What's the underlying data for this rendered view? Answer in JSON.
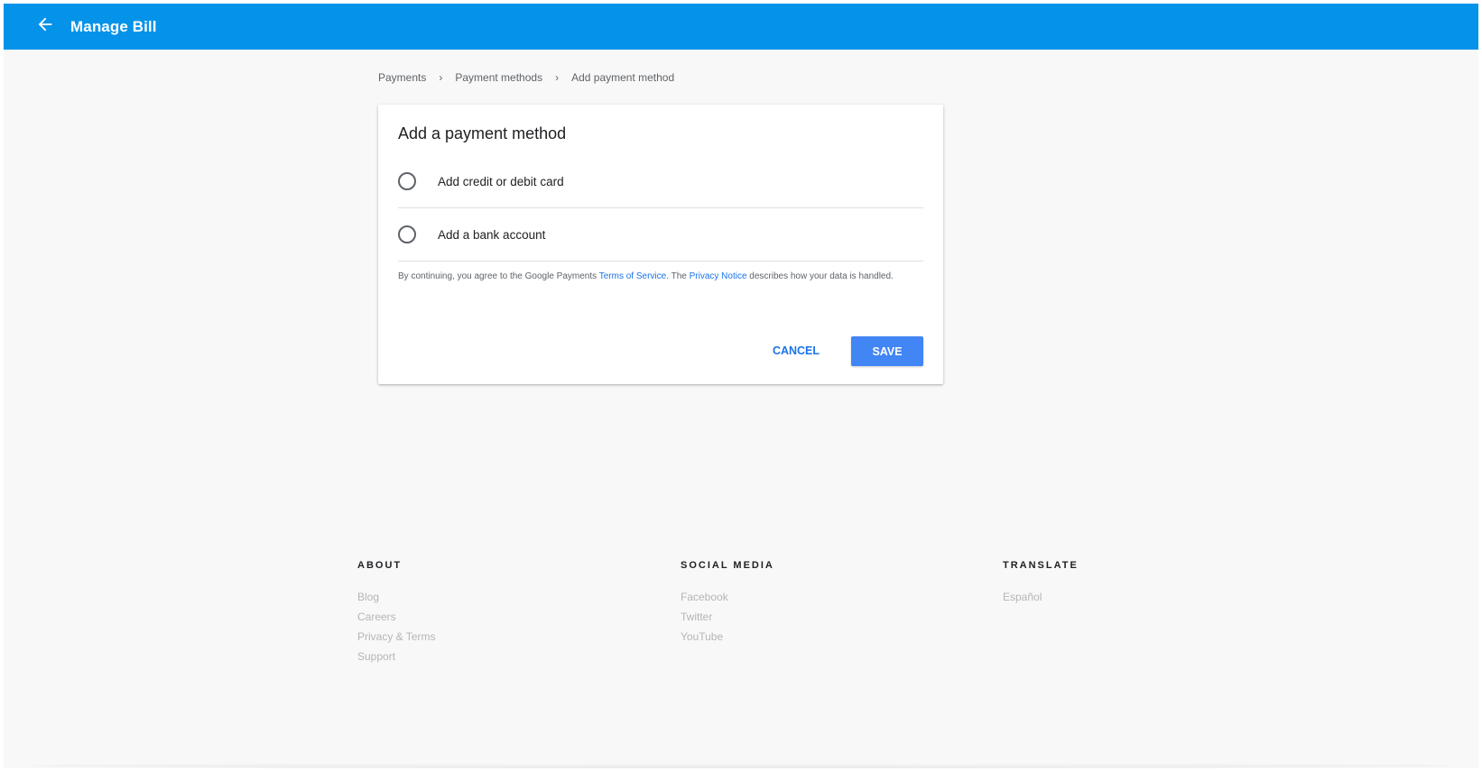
{
  "appbar": {
    "title": "Manage Bill",
    "back_icon": "arrow-left-icon",
    "background": "#0593ea"
  },
  "breadcrumb": {
    "items": [
      "Payments",
      "Payment methods",
      "Add payment method"
    ],
    "separator": "›"
  },
  "card": {
    "title": "Add a payment method",
    "options": [
      {
        "label": "Add credit or debit card",
        "selected": false
      },
      {
        "label": "Add a bank account",
        "selected": false
      }
    ],
    "legal": {
      "prefix": "By continuing, you agree to the Google Payments ",
      "tos_link": "Terms of Service",
      "middle": ". The ",
      "privacy_link": "Privacy Notice",
      "suffix": " describes how your data is handled."
    },
    "cancel_label": "CANCEL",
    "save_label": "SAVE",
    "accent": "#4285f4"
  },
  "footer": {
    "about": {
      "heading": "ABOUT",
      "links": [
        "Blog",
        "Careers",
        "Privacy & Terms",
        "Support"
      ]
    },
    "social": {
      "heading": "SOCIAL MEDIA",
      "links": [
        "Facebook",
        "Twitter",
        "YouTube"
      ]
    },
    "translate": {
      "heading": "TRANSLATE",
      "links": [
        "Español"
      ]
    }
  }
}
